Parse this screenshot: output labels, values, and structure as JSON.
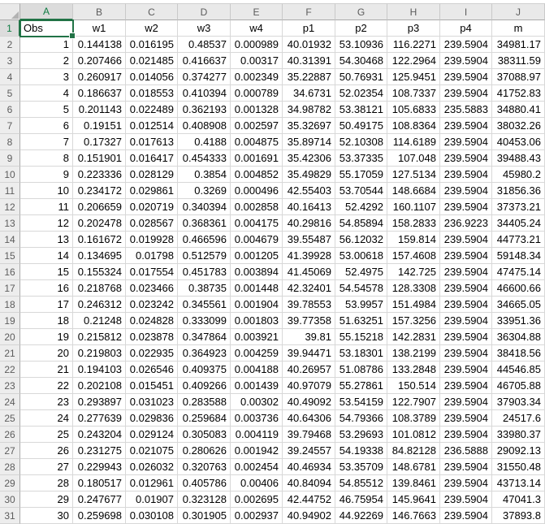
{
  "app": {
    "type": "spreadsheet-grid-view"
  },
  "colors": {
    "selection_green": "#217346",
    "selected_header_text": "#0E7C42",
    "header_bg": "#E9E9E9",
    "selected_header_bg": "#DCDCDC",
    "gridline": "#D8D8D8",
    "cell_text": "#000000",
    "header_text": "#5C5C5C"
  },
  "selection": {
    "active_cell": "A1",
    "active_cell_value": "Obs",
    "selected_column": "A",
    "selected_row": 1
  },
  "sheet": {
    "column_letters": [
      "A",
      "B",
      "C",
      "D",
      "E",
      "F",
      "G",
      "H",
      "I",
      "J"
    ],
    "row_numbers": [
      1,
      2,
      3,
      4,
      5,
      6,
      7,
      8,
      9,
      10,
      11,
      12,
      13,
      14,
      15,
      16,
      17,
      18,
      19,
      20,
      21,
      22,
      23,
      24,
      25,
      26,
      27,
      28,
      29,
      30,
      31
    ],
    "field_headers": [
      "Obs",
      "w1",
      "w2",
      "w3",
      "w4",
      "p1",
      "p2",
      "p3",
      "p4",
      "m"
    ],
    "rows": [
      [
        "1",
        "0.144138",
        "0.016195",
        "0.48537",
        "0.000989",
        "40.01932",
        "53.10936",
        "116.2271",
        "239.5904",
        "34981.17"
      ],
      [
        "2",
        "0.207466",
        "0.021485",
        "0.416637",
        "0.00317",
        "40.31391",
        "54.30468",
        "122.2964",
        "239.5904",
        "38311.59"
      ],
      [
        "3",
        "0.260917",
        "0.014056",
        "0.374277",
        "0.002349",
        "35.22887",
        "50.76931",
        "125.9451",
        "239.5904",
        "37088.97"
      ],
      [
        "4",
        "0.186637",
        "0.018553",
        "0.410394",
        "0.000789",
        "34.6731",
        "52.02354",
        "108.7337",
        "239.5904",
        "41752.83"
      ],
      [
        "5",
        "0.201143",
        "0.022489",
        "0.362193",
        "0.001328",
        "34.98782",
        "53.38121",
        "105.6833",
        "235.5883",
        "34880.41"
      ],
      [
        "6",
        "0.19151",
        "0.012514",
        "0.408908",
        "0.002597",
        "35.32697",
        "50.49175",
        "108.8364",
        "239.5904",
        "38032.26"
      ],
      [
        "7",
        "0.17327",
        "0.017613",
        "0.4188",
        "0.004875",
        "35.89714",
        "52.10308",
        "114.6189",
        "239.5904",
        "40453.06"
      ],
      [
        "8",
        "0.151901",
        "0.016417",
        "0.454333",
        "0.001691",
        "35.42306",
        "53.37335",
        "107.048",
        "239.5904",
        "39488.43"
      ],
      [
        "9",
        "0.223336",
        "0.028129",
        "0.3854",
        "0.004852",
        "35.49829",
        "55.17059",
        "127.5134",
        "239.5904",
        "45980.2"
      ],
      [
        "10",
        "0.234172",
        "0.029861",
        "0.3269",
        "0.000496",
        "42.55403",
        "53.70544",
        "148.6684",
        "239.5904",
        "31856.36"
      ],
      [
        "11",
        "0.206659",
        "0.020719",
        "0.340394",
        "0.002858",
        "40.16413",
        "52.4292",
        "160.1107",
        "239.5904",
        "37373.21"
      ],
      [
        "12",
        "0.202478",
        "0.028567",
        "0.368361",
        "0.004175",
        "40.29816",
        "54.85894",
        "158.2833",
        "236.9223",
        "34405.24"
      ],
      [
        "13",
        "0.161672",
        "0.019928",
        "0.466596",
        "0.004679",
        "39.55487",
        "56.12032",
        "159.814",
        "239.5904",
        "44773.21"
      ],
      [
        "14",
        "0.134695",
        "0.01798",
        "0.512579",
        "0.001205",
        "41.39928",
        "53.00618",
        "157.4608",
        "239.5904",
        "59148.34"
      ],
      [
        "15",
        "0.155324",
        "0.017554",
        "0.451783",
        "0.003894",
        "41.45069",
        "52.4975",
        "142.725",
        "239.5904",
        "47475.14"
      ],
      [
        "16",
        "0.218768",
        "0.023466",
        "0.38735",
        "0.001448",
        "42.32401",
        "54.54578",
        "128.3308",
        "239.5904",
        "46600.66"
      ],
      [
        "17",
        "0.246312",
        "0.023242",
        "0.345561",
        "0.001904",
        "39.78553",
        "53.9957",
        "151.4984",
        "239.5904",
        "34665.05"
      ],
      [
        "18",
        "0.21248",
        "0.024828",
        "0.333099",
        "0.001803",
        "39.77358",
        "51.63251",
        "157.3256",
        "239.5904",
        "33951.36"
      ],
      [
        "19",
        "0.215812",
        "0.023878",
        "0.347864",
        "0.003921",
        "39.81",
        "55.15218",
        "142.2831",
        "239.5904",
        "36304.88"
      ],
      [
        "20",
        "0.219803",
        "0.022935",
        "0.364923",
        "0.004259",
        "39.94471",
        "53.18301",
        "138.2199",
        "239.5904",
        "38418.56"
      ],
      [
        "21",
        "0.194103",
        "0.026546",
        "0.409375",
        "0.004188",
        "40.26957",
        "51.08786",
        "133.2848",
        "239.5904",
        "44546.85"
      ],
      [
        "22",
        "0.202108",
        "0.015451",
        "0.409266",
        "0.001439",
        "40.97079",
        "55.27861",
        "150.514",
        "239.5904",
        "46705.88"
      ],
      [
        "23",
        "0.293897",
        "0.031023",
        "0.283588",
        "0.00302",
        "40.49092",
        "53.54159",
        "122.7907",
        "239.5904",
        "37903.34"
      ],
      [
        "24",
        "0.277639",
        "0.029836",
        "0.259684",
        "0.003736",
        "40.64306",
        "54.79366",
        "108.3789",
        "239.5904",
        "24517.6"
      ],
      [
        "25",
        "0.243204",
        "0.029124",
        "0.305083",
        "0.004119",
        "39.79468",
        "53.29693",
        "101.0812",
        "239.5904",
        "33980.37"
      ],
      [
        "26",
        "0.231275",
        "0.021075",
        "0.280626",
        "0.001942",
        "39.24557",
        "54.19338",
        "84.82128",
        "236.5888",
        "29092.13"
      ],
      [
        "27",
        "0.229943",
        "0.026032",
        "0.320763",
        "0.002454",
        "40.46934",
        "53.35709",
        "148.6781",
        "239.5904",
        "31550.48"
      ],
      [
        "28",
        "0.180517",
        "0.012961",
        "0.405786",
        "0.00406",
        "40.84094",
        "54.85512",
        "139.8461",
        "239.5904",
        "43713.14"
      ],
      [
        "29",
        "0.247677",
        "0.01907",
        "0.323128",
        "0.002695",
        "42.44752",
        "46.75954",
        "145.9641",
        "239.5904",
        "47041.3"
      ],
      [
        "30",
        "0.259698",
        "0.030108",
        "0.301905",
        "0.002937",
        "40.94902",
        "44.92269",
        "146.7663",
        "239.5904",
        "37893.8"
      ]
    ]
  }
}
